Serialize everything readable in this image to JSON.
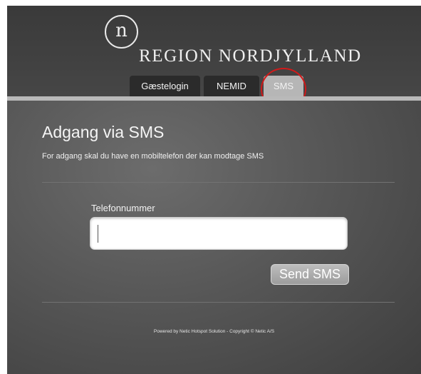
{
  "header": {
    "logo_mark": "n",
    "logo_text": "REGION NORDJYLLAND"
  },
  "tabs": [
    {
      "label": "Gæstelogin",
      "active": false
    },
    {
      "label": "NEMID",
      "active": false
    },
    {
      "label": "SMS",
      "active": true
    }
  ],
  "main": {
    "title": "Adgang via SMS",
    "description": "For adgang skal du have en mobiltelefon der kan modtage SMS",
    "phone_label": "Telefonnummer",
    "phone_value": "",
    "send_label": "Send SMS"
  },
  "footer": {
    "text": "Powered by Netic Hotspot Solution - Copyright © Netic A/S"
  },
  "colors": {
    "highlight_ring": "#d11a1a",
    "active_tab": "#b6b6b6",
    "inactive_tab": "#2b2b2b"
  }
}
